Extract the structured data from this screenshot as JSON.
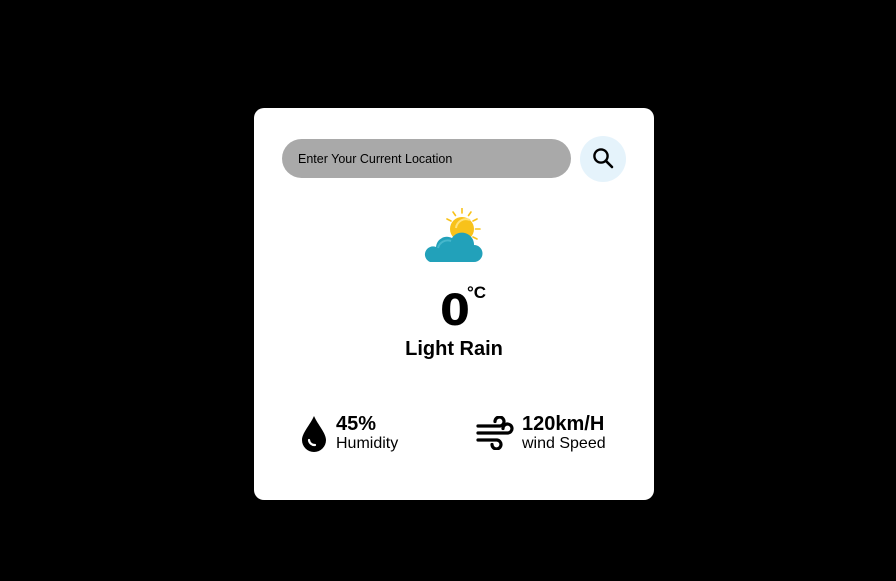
{
  "search": {
    "placeholder": "Enter Your Current Location",
    "icon": "search-icon"
  },
  "weather": {
    "icon": "partly-cloudy-sun-icon",
    "temperature": "0",
    "unit": "°C",
    "condition": "Light Rain"
  },
  "stats": {
    "humidity": {
      "value": "45%",
      "label": "Humidity",
      "icon": "water-drop-icon"
    },
    "wind": {
      "value": "120km/H",
      "label": "wind Speed",
      "icon": "wind-icon"
    }
  },
  "colors": {
    "background": "#000000",
    "card": "#ffffff",
    "search_field": "#a9a9a9",
    "search_button": "#e5f3fb",
    "sun": "#f8c21a",
    "cloud": "#22a1ba",
    "text": "#000000"
  }
}
